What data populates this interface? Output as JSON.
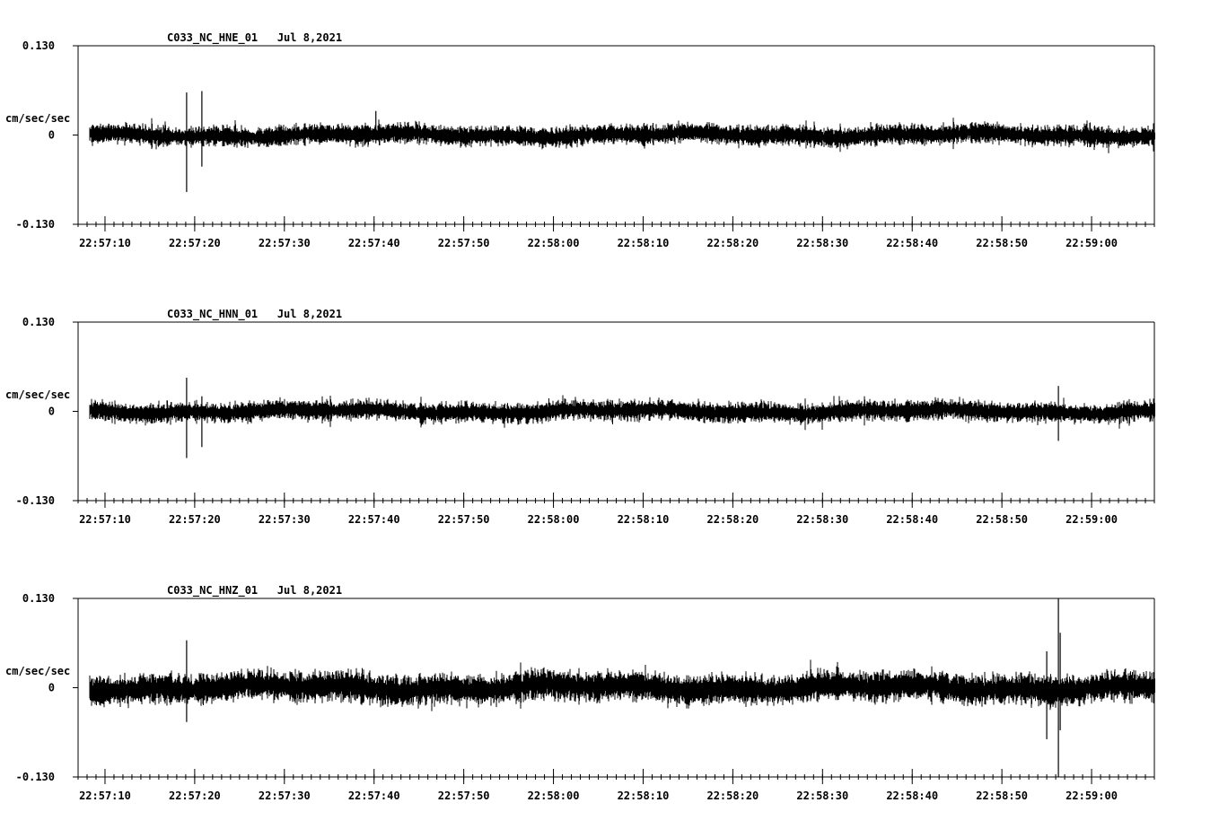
{
  "colors": {
    "background": "#ffffff",
    "trace": "#000000",
    "axis": "#000000"
  },
  "chart_data": [
    {
      "type": "line",
      "title": "C033_NC_HNE_01   Jul 8,2021",
      "ylabel": "cm/sec/sec",
      "ytick_labels": [
        "0.130",
        "0",
        "-0.130"
      ],
      "ylim": [
        -0.13,
        0.13
      ],
      "xlim": [
        "22:57:07",
        "22:59:07"
      ],
      "xtick_labels": [
        "22:57:10",
        "22:57:20",
        "22:57:30",
        "22:57:40",
        "22:57:50",
        "22:58:00",
        "22:58:10",
        "22:58:20",
        "22:58:30",
        "22:58:40",
        "22:58:50",
        "22:59:00"
      ],
      "minor_tick_interval_s": 1,
      "grid": false,
      "series": [
        {
          "trace_start": "22:57:08.4",
          "trace_end": "22:59:07",
          "noise_amplitude": 0.016,
          "spikes": [
            {
              "time": "22:57:19.1",
              "max": 0.062,
              "min": -0.083
            },
            {
              "time": "22:57:20.8",
              "max": 0.064,
              "min": -0.046
            },
            {
              "time": "22:57:40.2",
              "max": 0.035,
              "min": -0.012
            }
          ]
        }
      ]
    },
    {
      "type": "line",
      "title": "C033_NC_HNN_01   Jul 8,2021",
      "ylabel": "cm/sec/sec",
      "ytick_labels": [
        "0.130",
        "0",
        "-0.130"
      ],
      "ylim": [
        -0.13,
        0.13
      ],
      "xlim": [
        "22:57:07",
        "22:59:07"
      ],
      "xtick_labels": [
        "22:57:10",
        "22:57:20",
        "22:57:30",
        "22:57:40",
        "22:57:50",
        "22:58:00",
        "22:58:10",
        "22:58:20",
        "22:58:30",
        "22:58:40",
        "22:58:50",
        "22:59:00"
      ],
      "minor_tick_interval_s": 1,
      "grid": false,
      "series": [
        {
          "trace_start": "22:57:08.4",
          "trace_end": "22:59:07",
          "noise_amplitude": 0.016,
          "spikes": [
            {
              "time": "22:57:19.1",
              "max": 0.049,
              "min": -0.068
            },
            {
              "time": "22:57:20.8",
              "max": 0.022,
              "min": -0.052
            },
            {
              "time": "22:58:56.3",
              "max": 0.037,
              "min": -0.043
            }
          ]
        }
      ]
    },
    {
      "type": "line",
      "title": "C033_NC_HNZ_01   Jul 8,2021",
      "ylabel": "cm/sec/sec",
      "ytick_labels": [
        "0.130",
        "0",
        "-0.130"
      ],
      "ylim": [
        -0.13,
        0.13
      ],
      "xlim": [
        "22:57:07",
        "22:59:07"
      ],
      "xtick_labels": [
        "22:57:10",
        "22:57:20",
        "22:57:30",
        "22:57:40",
        "22:57:50",
        "22:58:00",
        "22:58:10",
        "22:58:20",
        "22:58:30",
        "22:58:40",
        "22:58:50",
        "22:59:00"
      ],
      "minor_tick_interval_s": 1,
      "grid": false,
      "series": [
        {
          "trace_start": "22:57:08.4",
          "trace_end": "22:59:07",
          "noise_amplitude": 0.024,
          "spikes": [
            {
              "time": "22:57:19.1",
              "max": 0.069,
              "min": -0.05
            },
            {
              "time": "22:58:55.0",
              "max": 0.053,
              "min": -0.075
            },
            {
              "time": "22:58:56.3",
              "max": 0.13,
              "min": -0.13
            },
            {
              "time": "22:58:56.5",
              "max": 0.08,
              "min": -0.062
            }
          ]
        }
      ]
    }
  ]
}
